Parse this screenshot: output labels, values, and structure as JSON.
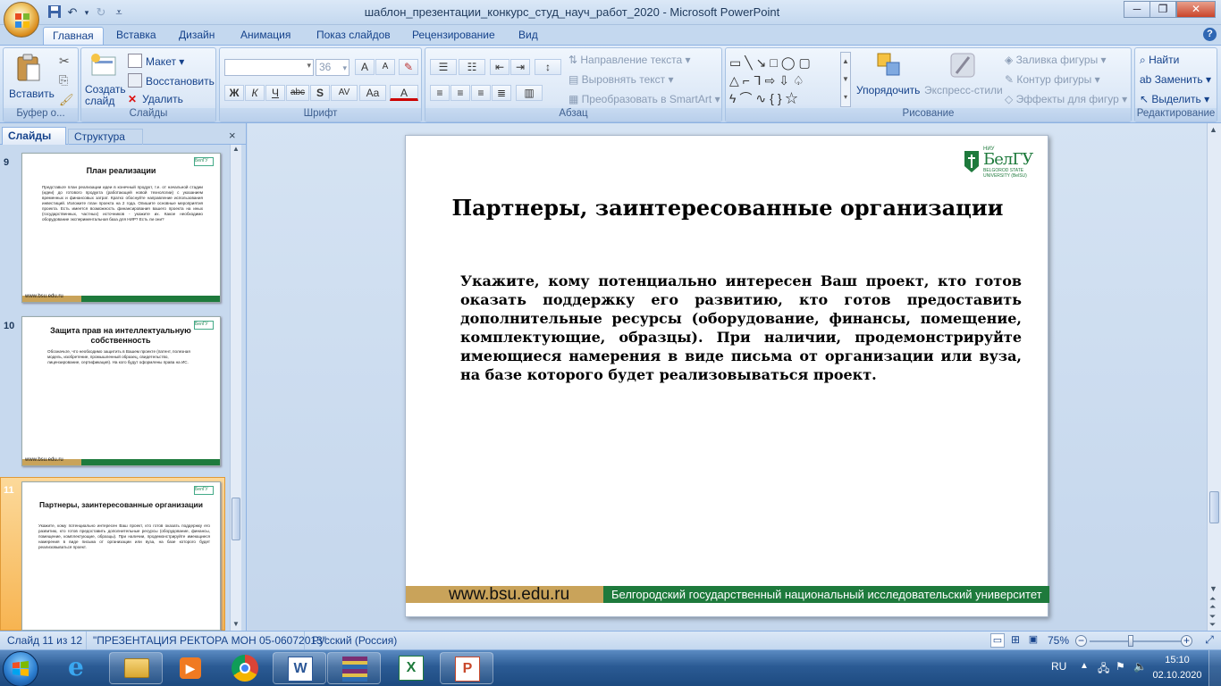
{
  "window": {
    "title": "шаблон_презентации_конкурс_студ_науч_работ_2020 - Microsoft PowerPoint",
    "controls": {
      "minimize": "─",
      "restore": "❐",
      "close": "✕"
    },
    "help": "?"
  },
  "ribbon_tabs": [
    {
      "label": "Главная",
      "active": true
    },
    {
      "label": "Вставка"
    },
    {
      "label": "Дизайн"
    },
    {
      "label": "Анимация"
    },
    {
      "label": "Показ слайдов"
    },
    {
      "label": "Рецензирование"
    },
    {
      "label": "Вид"
    }
  ],
  "ribbon": {
    "clipboard": {
      "label": "Буфер о...",
      "paste": "Вставить"
    },
    "slides": {
      "label": "Слайды",
      "new_slide": "Создать\nслайд",
      "layout": "Макет",
      "reset": "Восстановить",
      "delete": "Удалить"
    },
    "font": {
      "label": "Шрифт",
      "font_name": "",
      "font_size": "36",
      "bold": "Ж",
      "italic": "К",
      "underline": "Ч",
      "strike": "abc",
      "shadow": "S",
      "spacing": "AV",
      "case": "Aa",
      "grow": "A",
      "shrink": "A",
      "color": "A"
    },
    "paragraph": {
      "label": "Абзац",
      "text_direction": "Направление текста",
      "align_text": "Выровнять текст",
      "smartart": "Преобразовать в SmartArt"
    },
    "drawing": {
      "label": "Рисование",
      "arrange": "Упорядочить",
      "quick_styles": "Экспресс-стили",
      "fill": "Заливка фигуры",
      "outline": "Контур фигуры",
      "effects": "Эффекты для фигур"
    },
    "editing": {
      "label": "Редактирование",
      "find": "Найти",
      "replace": "Заменить",
      "select": "Выделить"
    }
  },
  "left_panel": {
    "tab_slides": "Слайды",
    "tab_outline": "Структура",
    "close": "×",
    "thumbnails": [
      {
        "number": "9",
        "title": "План реализации",
        "text": "Представьте план реализации идеи в конечный продукт, т.е. от начальной стадии (идеи) до готового продукта (работающей новой технологии) с указанием временных и финансовых затрат. Кратко обоснуйте направление использования инвестиций. Изложите план проекта на 2 года. Опишите основные мероприятия проекта. Есть имеется возможность финансирования вашего проекта на иных (государственных, частных) источников - укажите их. Какое необходимо оборудование экспериментальная база для НИР? Есть ли они?"
      },
      {
        "number": "10",
        "title": "Защита прав на интеллектуальную собственность",
        "text": "Обозначьте, что необходимо защитить в Вашем проекте (патент, полезная модель, изобретение, промышленный образец, свидетельство, лицензирование, сертификация). На кого будут оформлены права на ИС."
      },
      {
        "number": "11",
        "title": "Партнеры, заинтересованные организации",
        "text": "Укажите, кому потенциально интересен Ваш проект, кто готов оказать поддержку его развитию, кто готов предоставить дополнительные ресурсы (оборудование, финансы, помещение, комплектующие, образцы). При наличии, продемонстрируйте имеющиеся намерения в виде письма от организации или вуза, на базе которого будет реализовываться проект.",
        "selected": true
      }
    ],
    "footer_url": "www.bsu.edu.ru"
  },
  "slide": {
    "title": "Партнеры, заинтересованные организации",
    "body": "Укажите, кому потенциально интересен Ваш проект, кто готов оказать поддержку его развитию, кто готов предоставить дополнительные ресурсы (оборудование, финансы, помещение, комплектующие, образцы). При наличии, продемонстрируйте имеющиеся намерения в виде письма от организации или вуза, на базе которого будет реализовываться проект.",
    "logo": {
      "top": "НИУ",
      "main": "БелГУ",
      "sub1": "BELGOROD STATE",
      "sub2": "UNIVERSITY (BelSU)"
    },
    "footer_url": "www.bsu.edu.ru",
    "footer_university": "Белгородский государственный национальный исследовательский университет",
    "colors": {
      "footer_green": "#1e7a3c",
      "footer_gold": "#c9a35a"
    }
  },
  "status_bar": {
    "slide_position": "Слайд 11 из 12",
    "theme": "\"ПРЕЗЕНТАЦИЯ РЕКТОРА МОН 05-06072013\"",
    "language": "Русский (Россия)",
    "zoom": "75%",
    "zoom_fraction": 0.44
  },
  "taskbar": {
    "language": "RU",
    "time": "15:10",
    "date": "02.10.2020",
    "apps": [
      "explorer-icon",
      "media-player-icon",
      "chrome-icon",
      "word-icon",
      "winrar-icon",
      "excel-icon",
      "powerpoint-icon"
    ]
  }
}
